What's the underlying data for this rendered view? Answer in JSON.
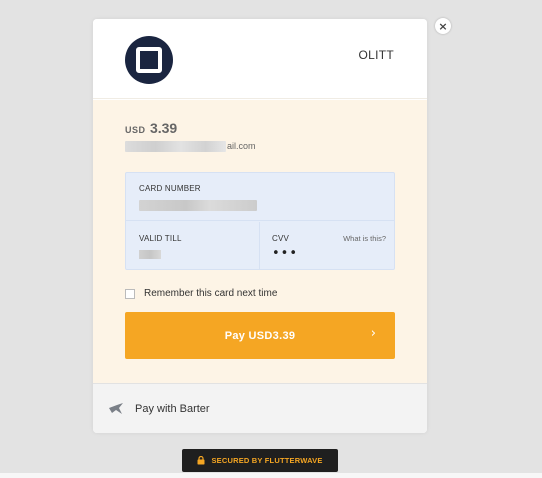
{
  "merchant": {
    "name": "OLITT"
  },
  "payment": {
    "currency": "USD",
    "amount": "3.39",
    "email_visible_suffix": "ail.com"
  },
  "card_form": {
    "card_number_label": "CARD NUMBER",
    "valid_till_label": "VALID TILL",
    "cvv_label": "CVV",
    "cvv_value": "•••",
    "what_is_this": "What is this?"
  },
  "remember": {
    "label": "Remember this card next time",
    "checked": false
  },
  "pay_button": {
    "label": "Pay USD3.39",
    "chevron": "›"
  },
  "barter": {
    "label": "Pay with Barter",
    "icon": "barter-bird-icon"
  },
  "footer": {
    "secured_label": "SECURED BY FLUTTERWAVE",
    "icon": "lock-icon"
  },
  "close": {
    "glyph": "×",
    "icon": "close-icon"
  },
  "colors": {
    "accent": "#f5a623",
    "logo_bg": "#1a2540",
    "form_bg": "#fdf4e6",
    "card_box_bg": "#e6edf9",
    "secured_bg": "#1f1f1f"
  }
}
